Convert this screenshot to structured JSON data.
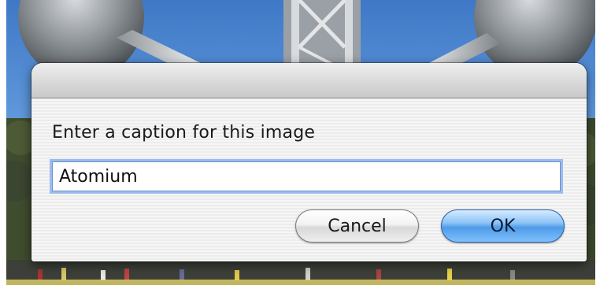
{
  "dialog": {
    "prompt": "Enter a caption for this image",
    "caption_value": "Atomium",
    "cancel_label": "Cancel",
    "ok_label": "OK"
  },
  "background": {
    "subject": "Atomium",
    "sky_color": "#4f88d2"
  },
  "colors": {
    "default_button": "#5aa6ee",
    "focus_ring": "#9cbcef"
  }
}
